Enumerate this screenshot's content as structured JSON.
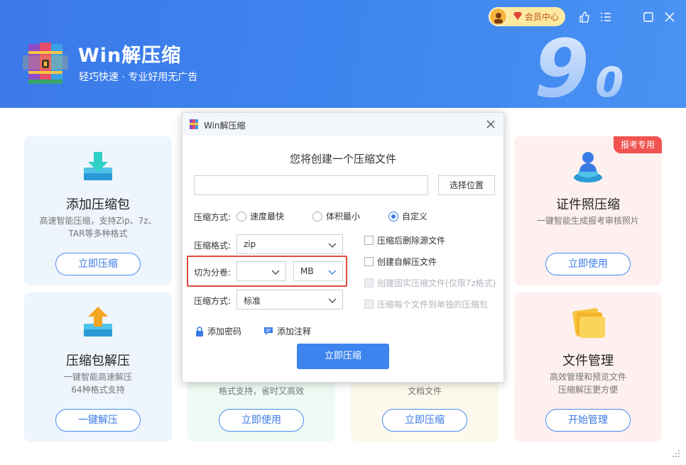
{
  "header": {
    "app_name": "Win解压缩",
    "slogan": "轻巧快速 · 专业好用无广告",
    "version_digit": "9",
    "version_minor": "0",
    "vip_label": "会员中心",
    "buttons": [
      "thumbs-up-icon",
      "menu-icon",
      "maximize-icon",
      "close-icon"
    ]
  },
  "cards": {
    "add_archive": {
      "title": "添加压缩包",
      "desc": "高速智能压缩，支持Zip、7z、TAR等多种格式",
      "button": "立即压缩"
    },
    "extract": {
      "title": "压缩包解压",
      "desc": "一键智能高速解压\n64种格式支持",
      "button": "一键解压"
    },
    "id_photo": {
      "badge": "报考专用",
      "title": "证件照压缩",
      "desc": "一键智能生成报考审核照片",
      "button": "立即使用"
    },
    "file_manage": {
      "title": "文件管理",
      "desc": "高效管理和预览文件\n压缩解压更方便",
      "button": "开始管理"
    },
    "middle_left": {
      "desc": "格式支持，省时又高效",
      "button": "立即使用"
    },
    "middle_right": {
      "desc": "文档文件",
      "button": "立即压缩"
    }
  },
  "dialog": {
    "title": "Win解压缩",
    "heading": "您将创建一个压缩文件",
    "path_value": "",
    "choose_location": "选择位置",
    "compress_mode_label": "压缩方式:",
    "modes": [
      "速度最快",
      "体积最小",
      "自定义"
    ],
    "selected_mode": "自定义",
    "format_label": "压缩格式:",
    "format_value": "zip",
    "split_label": "切为分卷:",
    "split_value": "",
    "split_unit": "MB",
    "level_label": "压缩方式:",
    "level_value": "标准",
    "options": [
      {
        "label": "压缩后删除源文件",
        "disabled": false
      },
      {
        "label": "创建自解压文件",
        "disabled": false
      },
      {
        "label": "创建固实压缩文件(仅限7z格式)",
        "disabled": true
      },
      {
        "label": "压缩每个文件到单独的压缩包",
        "disabled": true
      }
    ],
    "add_password": "添加密码",
    "add_comment": "添加注释",
    "submit": "立即压缩"
  },
  "colors": {
    "header_blue": "#3f86ef",
    "accent": "#3a7ae6",
    "highlight_red": "#e04a3c",
    "badge_red": "#f05350"
  }
}
